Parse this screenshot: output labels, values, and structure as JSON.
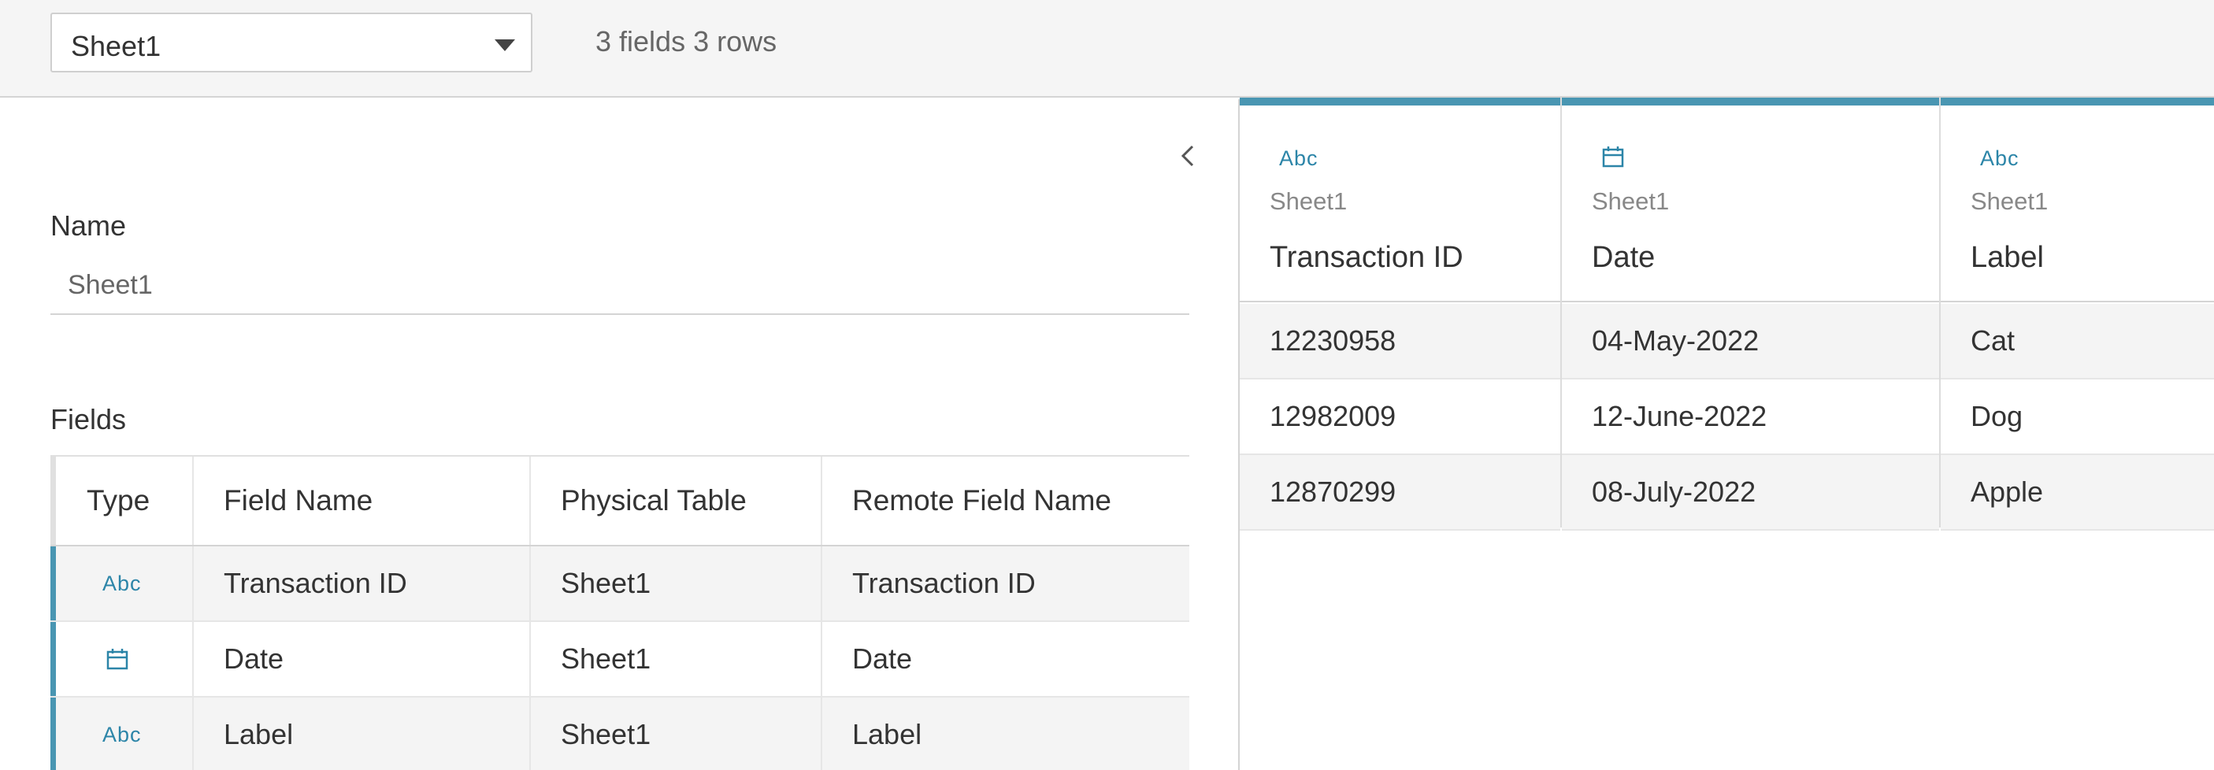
{
  "toolbar": {
    "sheet_select": "Sheet1",
    "summary": "3 fields 3 rows"
  },
  "details": {
    "name_label": "Name",
    "name_value": "Sheet1",
    "fields_label": "Fields"
  },
  "fields_table": {
    "headers": [
      "Type",
      "Field Name",
      "Physical Table",
      "Remote Field Name"
    ],
    "rows": [
      {
        "type": "Abc",
        "type_icon": "string-abc-icon",
        "field_name": "Transaction ID",
        "physical_table": "Sheet1",
        "remote_field_name": "Transaction ID"
      },
      {
        "type": "date",
        "type_icon": "calendar-icon",
        "field_name": "Date",
        "physical_table": "Sheet1",
        "remote_field_name": "Date"
      },
      {
        "type": "Abc",
        "type_icon": "string-abc-icon",
        "field_name": "Label",
        "physical_table": "Sheet1",
        "remote_field_name": "Label"
      }
    ]
  },
  "data_grid": {
    "columns": [
      {
        "type": "Abc",
        "type_icon": "string-abc-icon",
        "source": "Sheet1",
        "name": "Transaction ID"
      },
      {
        "type": "date",
        "type_icon": "calendar-icon",
        "source": "Sheet1",
        "name": "Date"
      },
      {
        "type": "Abc",
        "type_icon": "string-abc-icon",
        "source": "Sheet1",
        "name": "Label"
      }
    ],
    "rows": [
      [
        "12230958",
        "04-May-2022",
        "Cat"
      ],
      [
        "12982009",
        "12-June-2022",
        "Dog"
      ],
      [
        "12870299",
        "08-July-2022",
        "Apple"
      ]
    ]
  },
  "colors": {
    "accent": "#4996b2",
    "icon_blue": "#2c85a8",
    "toolbar_bg": "#f5f5f5",
    "row_shade": "#f4f4f4"
  }
}
